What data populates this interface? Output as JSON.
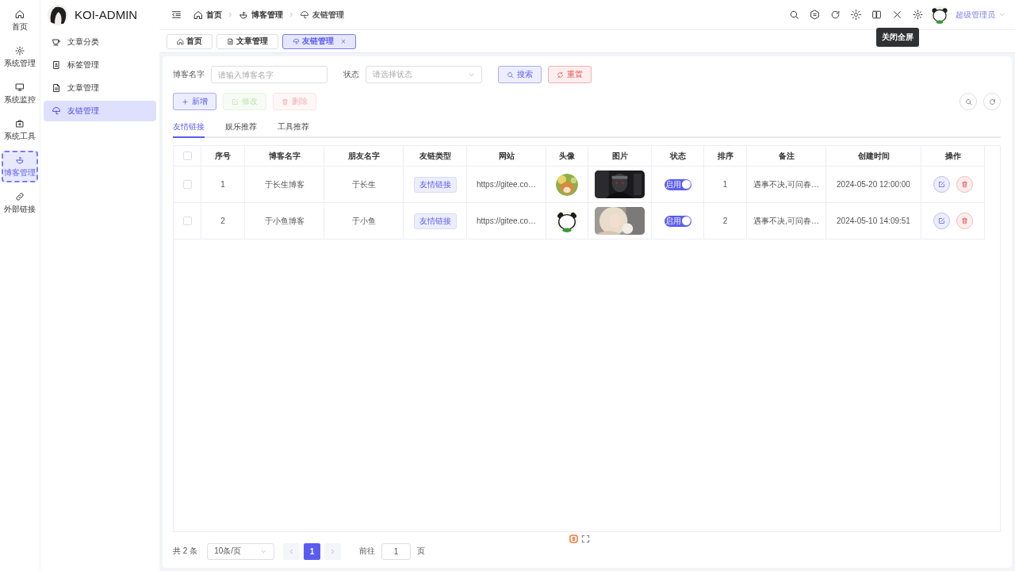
{
  "rail": [
    {
      "label": "首页",
      "selected": false
    },
    {
      "label": "系统管理",
      "selected": false
    },
    {
      "label": "系统监控",
      "selected": false
    },
    {
      "label": "系统工具",
      "selected": false
    },
    {
      "label": "博客管理",
      "selected": true
    },
    {
      "label": "外部链接",
      "selected": false
    }
  ],
  "app": {
    "title": "KOI-ADMIN"
  },
  "menu": [
    {
      "label": "文章分类",
      "selected": false
    },
    {
      "label": "标签管理",
      "selected": false
    },
    {
      "label": "文章管理",
      "selected": false
    },
    {
      "label": "友链管理",
      "selected": true
    }
  ],
  "breadcrumb": [
    {
      "label": "首页"
    },
    {
      "label": "博客管理"
    },
    {
      "label": "友链管理"
    }
  ],
  "header": {
    "tooltip": "关闭全屏",
    "user": "超级管理员"
  },
  "tabs": [
    {
      "label": "首页",
      "selected": false,
      "closable": false
    },
    {
      "label": "文章管理",
      "selected": false,
      "closable": false
    },
    {
      "label": "友链管理",
      "selected": true,
      "closable": true
    }
  ],
  "tab_close": "×",
  "filters": [
    {
      "label": "博客名字",
      "kind": "input",
      "placeholder": "请输入博客名字"
    },
    {
      "label": "状态",
      "kind": "select",
      "placeholder": "请选择状态"
    }
  ],
  "filter_buttons": [
    {
      "label": "搜索",
      "kind": "search"
    },
    {
      "label": "重置",
      "kind": "reset"
    }
  ],
  "actions": [
    {
      "label": "新增",
      "kind": "add",
      "disabled": false
    },
    {
      "label": "修改",
      "kind": "edit",
      "disabled": true
    },
    {
      "label": "删除",
      "kind": "delete",
      "disabled": true
    }
  ],
  "link_tabs": [
    {
      "label": "友情链接",
      "selected": true
    },
    {
      "label": "娱乐推荐",
      "selected": false
    },
    {
      "label": "工具推荐",
      "selected": false
    }
  ],
  "table": {
    "header_checked": false,
    "columns": [
      "序号",
      "博客名字",
      "朋友名字",
      "友链类型",
      "网站",
      "头像",
      "图片",
      "状态",
      "排序",
      "备注",
      "创建时间",
      "操作"
    ],
    "rows": [
      {
        "checked": false,
        "index": "1",
        "blog_name": "于长生博客",
        "friend_name": "于长生",
        "link_type": "友情链接",
        "website": "https://gitee.co…",
        "status": {
          "label": "启用",
          "on": true
        },
        "sort": "1",
        "remark": "遇事不决,可问春…",
        "created": "2024-05-20 12:00:00"
      },
      {
        "checked": false,
        "index": "2",
        "blog_name": "于小鱼博客",
        "friend_name": "于小鱼",
        "link_type": "友情链接",
        "website": "https://gitee.co…",
        "status": {
          "label": "启用",
          "on": true
        },
        "sort": "2",
        "remark": "遇事不决,可问春…",
        "created": "2024-05-10 14:09:51"
      }
    ]
  },
  "pagination": {
    "total": "共 2 条",
    "page_size": "10条/页",
    "pages": [
      {
        "label": "1",
        "selected": true
      }
    ],
    "goto_label": "前往",
    "goto_value": "1",
    "goto_suffix": "页"
  }
}
